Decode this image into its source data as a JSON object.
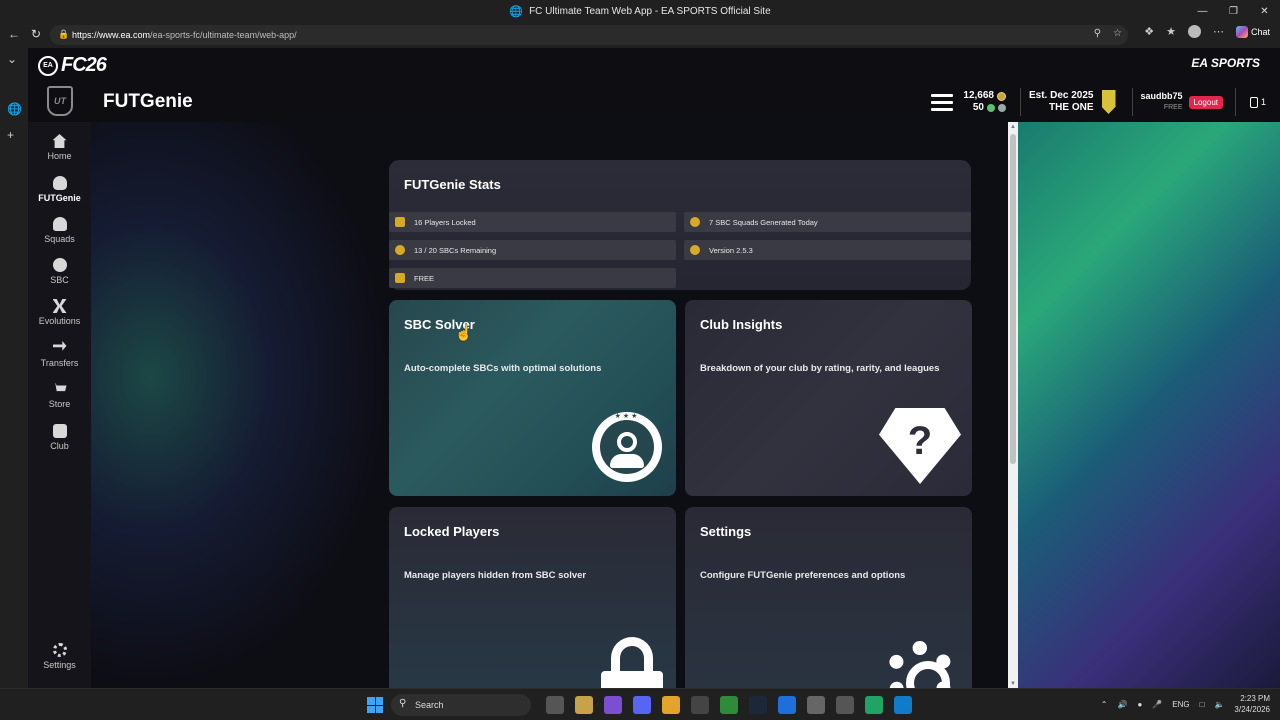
{
  "window": {
    "title": "FC Ultimate Team Web App - EA SPORTS Official Site"
  },
  "browser": {
    "url_host": "https://www.ea.com",
    "url_path": "/ea-sports-fc/ultimate-team/web-app/",
    "chat_label": "Chat"
  },
  "header": {
    "game_logo": "FC26",
    "publisher": "EA SPORTS",
    "app_title": "FUTGenie",
    "coins": "12,668",
    "points": "50",
    "club_est": "Est. Dec 2025",
    "club_name": "THE ONE",
    "username": "saudbb75",
    "plan": "FREE",
    "logout_label": "Logout",
    "notifications": "1"
  },
  "sidebar": {
    "logo": "UT",
    "items": [
      {
        "label": "Home",
        "icon": "home-icon"
      },
      {
        "label": "FUTGenie",
        "icon": "genie-icon"
      },
      {
        "label": "Squads",
        "icon": "squads-icon"
      },
      {
        "label": "SBC",
        "icon": "sbc-icon"
      },
      {
        "label": "Evolutions",
        "icon": "evolutions-icon"
      },
      {
        "label": "Transfers",
        "icon": "transfers-icon"
      },
      {
        "label": "Store",
        "icon": "store-icon"
      },
      {
        "label": "Club",
        "icon": "club-icon"
      }
    ],
    "settings_label": "Settings",
    "active": "FUTGenie"
  },
  "stats": {
    "title": "FUTGenie Stats",
    "players_locked": "16 Players Locked",
    "squads_generated": "7 SBC Squads Generated Today",
    "sbcs_remaining": "13 / 20 SBCs Remaining",
    "version": "Version 2.5.3",
    "plan": "FREE"
  },
  "cards": {
    "sbc_solver": {
      "title": "SBC Solver",
      "desc": "Auto-complete SBCs with optimal solutions"
    },
    "club_insights": {
      "title": "Club Insights",
      "desc": "Breakdown of your club by rating, rarity, and leagues"
    },
    "locked_players": {
      "title": "Locked Players",
      "desc": "Manage players hidden from SBC solver"
    },
    "settings": {
      "title": "Settings",
      "desc": "Configure FUTGenie preferences and options"
    }
  },
  "taskbar": {
    "search_placeholder": "Search",
    "language": "ENG",
    "time": "2:23 PM",
    "date": "3/24/2026"
  },
  "colors": {
    "accent_red": "#e2264d",
    "coin_gold": "#caa53a",
    "sbc_card": "#2b5a5e",
    "right_glow": "#2aa87a"
  }
}
